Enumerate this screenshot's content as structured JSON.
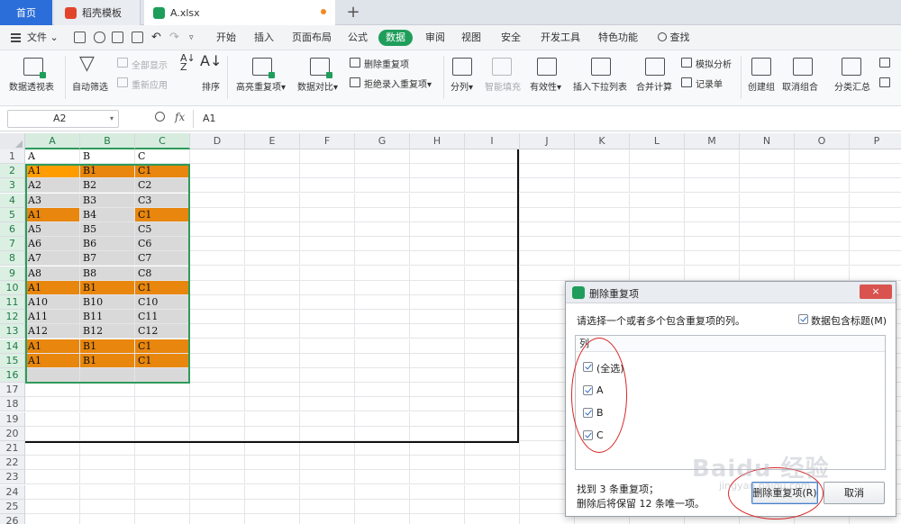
{
  "tabs": [
    {
      "label": "首页"
    },
    {
      "label": "稻壳模板"
    },
    {
      "label": "A.xlsx"
    }
  ],
  "menu": {
    "file": "文件",
    "items": [
      "开始",
      "插入",
      "页面布局",
      "公式",
      "数据",
      "审阅",
      "视图",
      "安全",
      "开发工具",
      "特色功能"
    ],
    "active": "数据",
    "search": "查找"
  },
  "ribbon": {
    "pivot": "数据透视表",
    "autofilter": "自动筛选",
    "show_all": "全部显示",
    "reapply": "重新应用",
    "sort": "排序",
    "highlight_dup": "高亮重复项",
    "compare": "数据对比",
    "delete_dup": "删除重复项",
    "reject_dup": "拒绝录入重复项",
    "split": "分列",
    "smart_fill": "智能填充",
    "validity": "有效性",
    "dropdown": "插入下拉列表",
    "consolidate": "合并计算",
    "simulate": "模拟分析",
    "record": "记录单",
    "group": "创建组",
    "ungroup": "取消组合",
    "subtotal": "分类汇总"
  },
  "formula_bar": {
    "name_box": "A2",
    "fx": "fx",
    "content": "A1"
  },
  "columns": [
    "A",
    "B",
    "C",
    "D",
    "E",
    "F",
    "G",
    "H",
    "I",
    "J",
    "K",
    "L",
    "M",
    "N",
    "O",
    "P"
  ],
  "rows": [
    "1",
    "2",
    "3",
    "4",
    "5",
    "6",
    "7",
    "8",
    "9",
    "10",
    "11",
    "12",
    "13",
    "14",
    "15",
    "16",
    "17",
    "18",
    "19",
    "20",
    "21",
    "22",
    "23",
    "24",
    "25",
    "26"
  ],
  "table": [
    {
      "a": "A",
      "b": "B",
      "c": "C",
      "hl": "none"
    },
    {
      "a": "A1",
      "b": "B1",
      "c": "C1",
      "hl": "row"
    },
    {
      "a": "A2",
      "b": "B2",
      "c": "C2",
      "hl": "none"
    },
    {
      "a": "A3",
      "b": "B3",
      "c": "C3",
      "hl": "none"
    },
    {
      "a": "A1",
      "b": "B4",
      "c": "C1",
      "hl": "ac"
    },
    {
      "a": "A5",
      "b": "B5",
      "c": "C5",
      "hl": "none"
    },
    {
      "a": "A6",
      "b": "B6",
      "c": "C6",
      "hl": "none"
    },
    {
      "a": "A7",
      "b": "B7",
      "c": "C7",
      "hl": "none"
    },
    {
      "a": "A8",
      "b": "B8",
      "c": "C8",
      "hl": "none"
    },
    {
      "a": "A1",
      "b": "B1",
      "c": "C1",
      "hl": "row"
    },
    {
      "a": "A10",
      "b": "B10",
      "c": "C10",
      "hl": "none"
    },
    {
      "a": "A11",
      "b": "B11",
      "c": "C11",
      "hl": "none"
    },
    {
      "a": "A12",
      "b": "B12",
      "c": "C12",
      "hl": "none"
    },
    {
      "a": "A1",
      "b": "B1",
      "c": "C1",
      "hl": "row"
    },
    {
      "a": "A1",
      "b": "B1",
      "c": "C1",
      "hl": "row"
    },
    {
      "a": "",
      "b": "",
      "c": "",
      "hl": "none"
    }
  ],
  "colors": {
    "highlight": "#e8860d",
    "selected_bg": "#d9d9d9",
    "accent": "#1e9e5a",
    "tab_blue": "#2b6ed9"
  },
  "dialog": {
    "title": "删除重复项",
    "close": "×",
    "prompt": "请选择一个或者多个包含重复项的列。",
    "header_checkbox": "数据包含标题(M)",
    "list_header": "列",
    "options": [
      "(全选)",
      "A",
      "B",
      "C"
    ],
    "status_line1": "找到 3 条重复项；",
    "status_line2": "删除后将保留 12 条唯一项。",
    "delete_button": "删除重复项(R)",
    "cancel_button": "取消"
  },
  "watermark": {
    "main": "Baidu 经验",
    "sub": "jingyan.baidu.com"
  }
}
